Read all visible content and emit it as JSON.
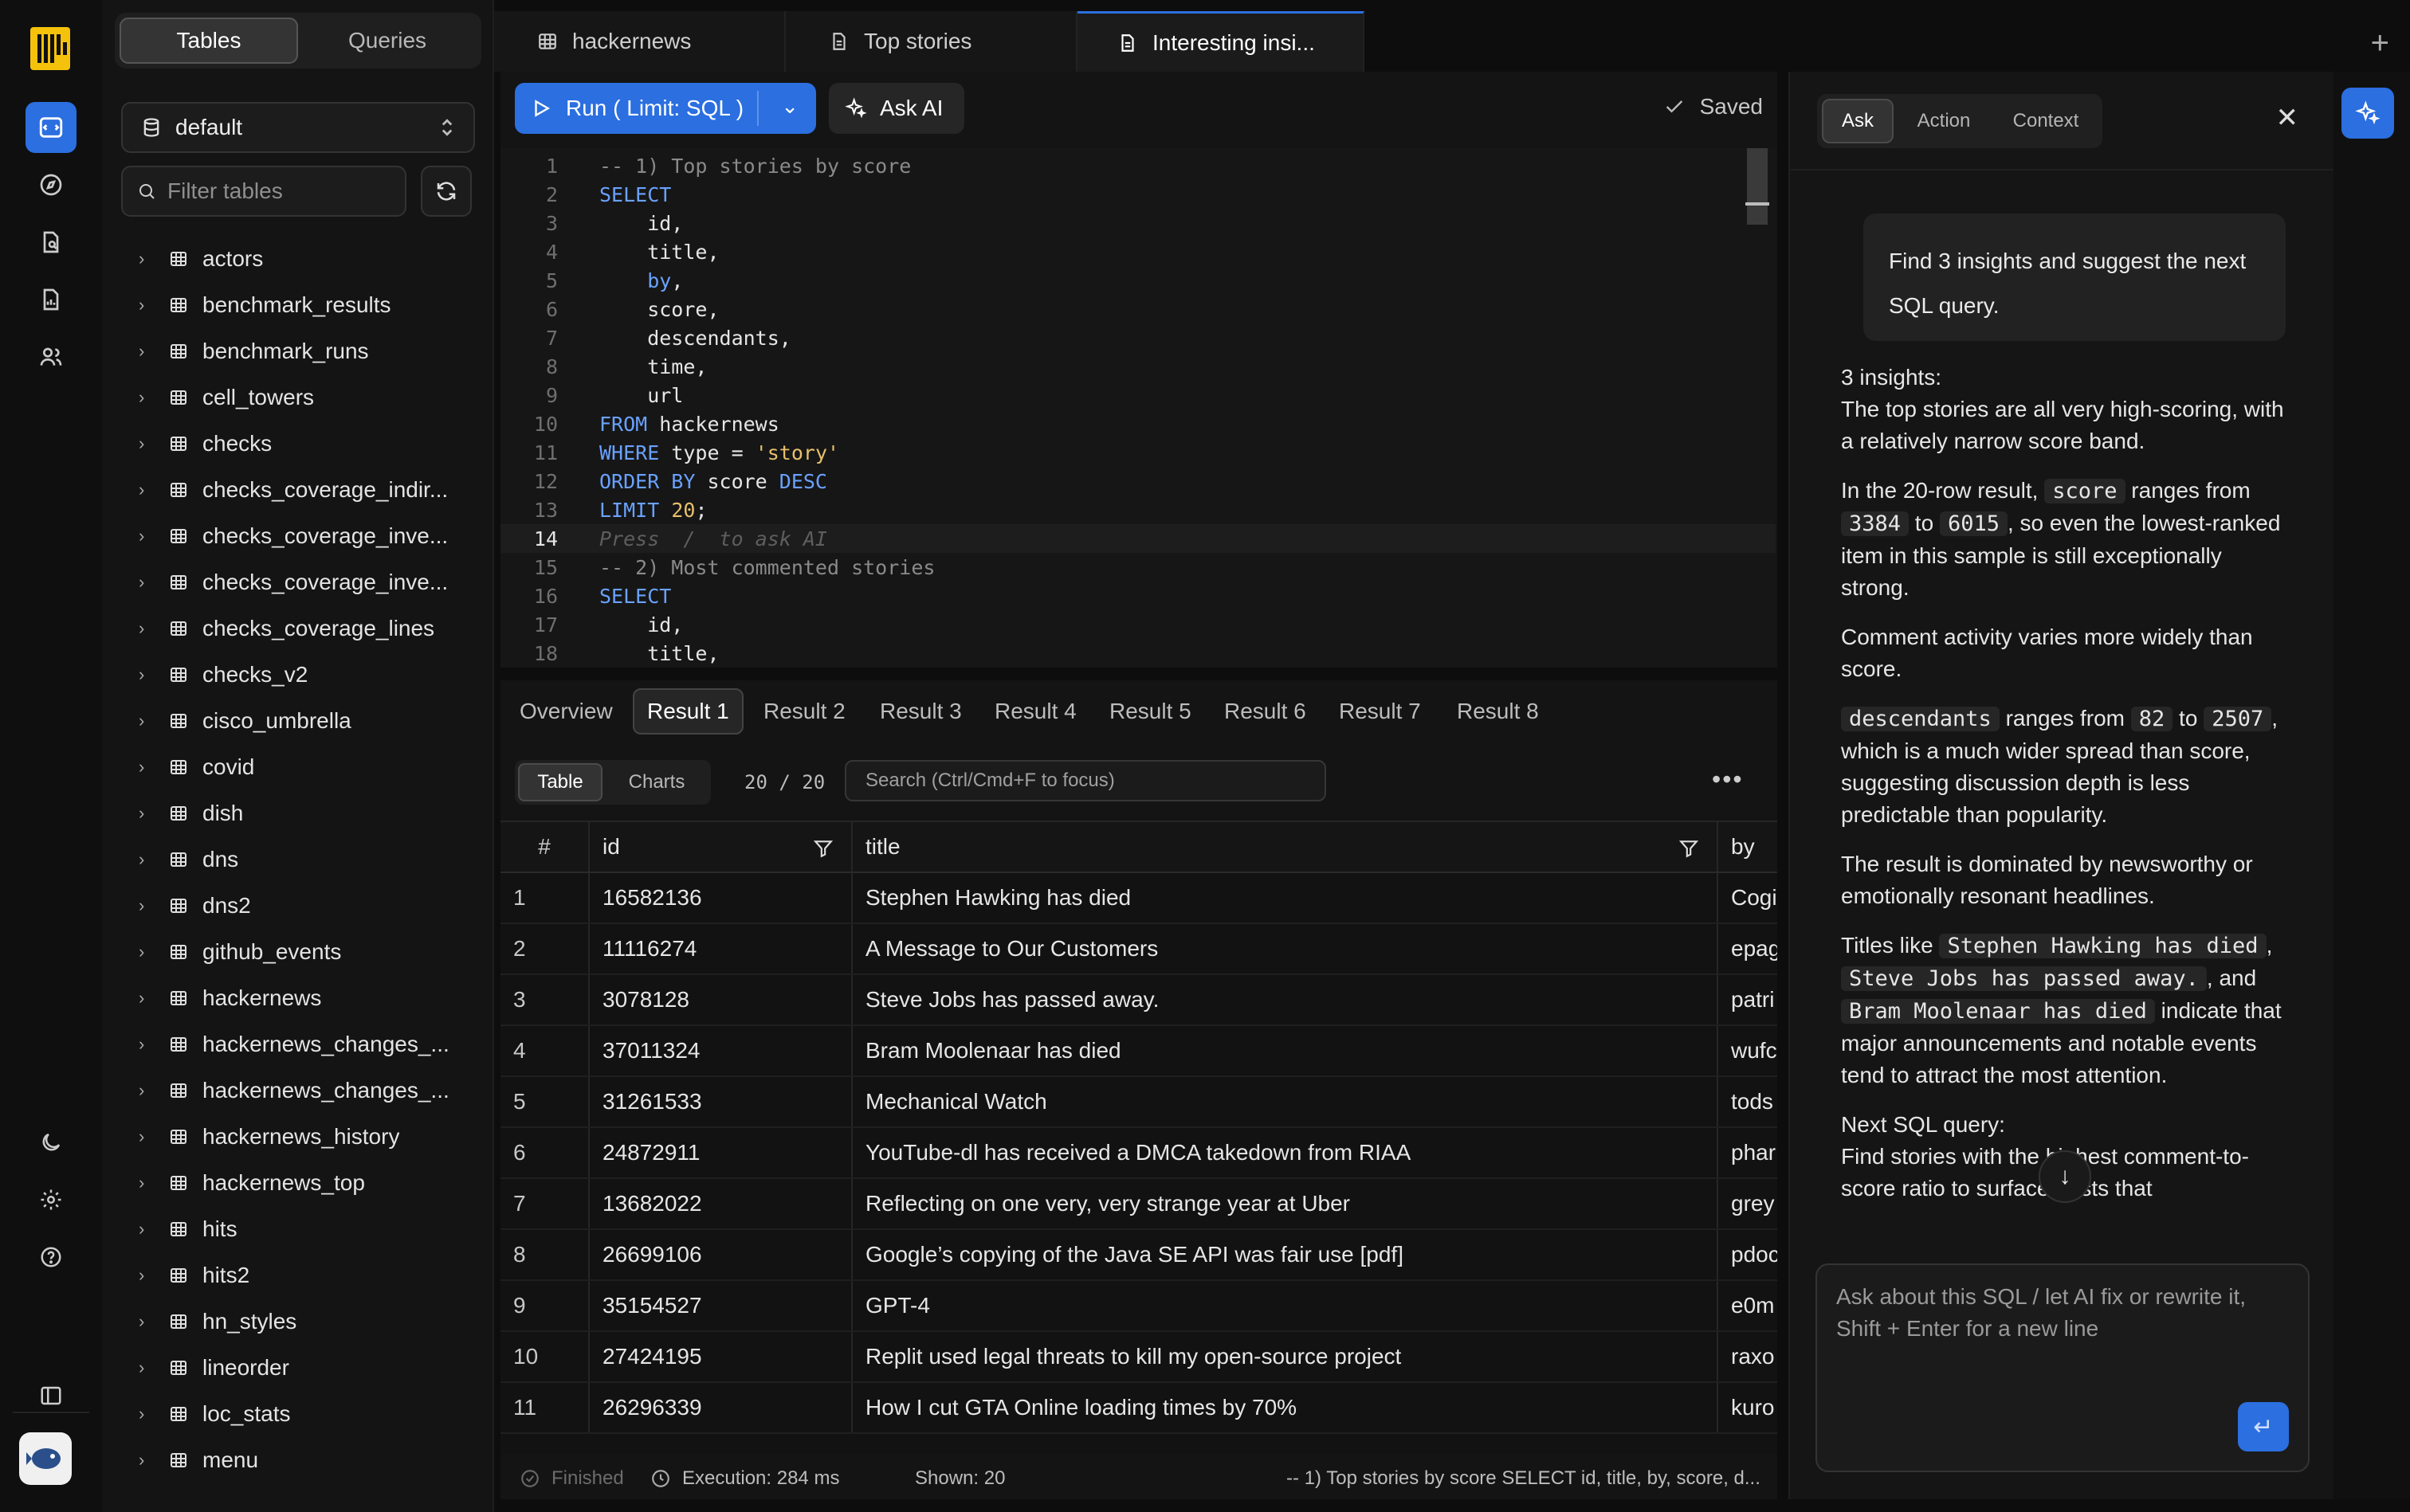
{
  "sidebar": {
    "mode_tabs": [
      "Tables",
      "Queries"
    ],
    "database": "default",
    "filter_placeholder": "Filter tables",
    "tables": [
      "actors",
      "benchmark_results",
      "benchmark_runs",
      "cell_towers",
      "checks",
      "checks_coverage_indir...",
      "checks_coverage_inve...",
      "checks_coverage_inve...",
      "checks_coverage_lines",
      "checks_v2",
      "cisco_umbrella",
      "covid",
      "dish",
      "dns",
      "dns2",
      "github_events",
      "hackernews",
      "hackernews_changes_...",
      "hackernews_changes_...",
      "hackernews_history",
      "hackernews_top",
      "hits",
      "hits2",
      "hn_styles",
      "lineorder",
      "loc_stats",
      "menu"
    ]
  },
  "tabs": [
    {
      "label": "hackernews",
      "icon": "table-icon"
    },
    {
      "label": "Top stories",
      "icon": "document-icon"
    },
    {
      "label": "Interesting insi...",
      "icon": "document-icon"
    }
  ],
  "toolbar": {
    "run_label": "Run ( Limit: SQL )",
    "ask_label": "Ask AI",
    "saved_label": "Saved"
  },
  "editor": {
    "lines": [
      {
        "n": "1",
        "html": "<span class=\"cm\">-- 1) Top stories by score</span>"
      },
      {
        "n": "2",
        "html": "<span class=\"kw\">SELECT</span>"
      },
      {
        "n": "3",
        "html": "    id,"
      },
      {
        "n": "4",
        "html": "    title,"
      },
      {
        "n": "5",
        "html": "    <span class=\"kw\">by</span>,"
      },
      {
        "n": "6",
        "html": "    score,"
      },
      {
        "n": "7",
        "html": "    descendants,"
      },
      {
        "n": "8",
        "html": "    time,"
      },
      {
        "n": "9",
        "html": "    url"
      },
      {
        "n": "10",
        "html": "<span class=\"kw\">FROM</span> hackernews"
      },
      {
        "n": "11",
        "html": "<span class=\"kw\">WHERE</span> type = <span class=\"str\">'story'</span>"
      },
      {
        "n": "12",
        "html": "<span class=\"kw\">ORDER BY</span> score <span class=\"kw\">DESC</span>"
      },
      {
        "n": "13",
        "html": "<span class=\"kw\">LIMIT</span> <span class=\"num\">20</span>;"
      },
      {
        "n": "14",
        "html": "<span class=\"hint\">Press  /  to ask AI</span>",
        "current": true
      },
      {
        "n": "15",
        "html": "<span class=\"cm\">-- 2) Most commented stories</span>"
      },
      {
        "n": "16",
        "html": "<span class=\"kw\">SELECT</span>"
      },
      {
        "n": "17",
        "html": "    id,"
      },
      {
        "n": "18",
        "html": "    title,"
      }
    ]
  },
  "results": {
    "tabs": [
      "Overview",
      "Result 1",
      "Result 2",
      "Result 3",
      "Result 4",
      "Result 5",
      "Result 6",
      "Result 7",
      "Result 8"
    ],
    "active_tab": "Result 1",
    "view_tabs": [
      "Table",
      "Charts"
    ],
    "count": "20 / 20",
    "search_placeholder": "Search (Ctrl/Cmd+F to focus)",
    "columns": [
      "#",
      "id",
      "title",
      "by"
    ],
    "rows": [
      [
        "1",
        "16582136",
        "Stephen Hawking has died",
        "Cogi"
      ],
      [
        "2",
        "11116274",
        "A Message to Our Customers",
        "epag"
      ],
      [
        "3",
        "3078128",
        "Steve Jobs has passed away.",
        "patri"
      ],
      [
        "4",
        "37011324",
        "Bram Moolenaar has died",
        "wufc"
      ],
      [
        "5",
        "31261533",
        "Mechanical Watch",
        "tods"
      ],
      [
        "6",
        "24872911",
        "YouTube-dl has received a DMCA takedown from RIAA",
        "phar"
      ],
      [
        "7",
        "13682022",
        "Reflecting on one very, very strange year at Uber",
        "grey"
      ],
      [
        "8",
        "26699106",
        "Google’s copying of the Java SE API was fair use [pdf]",
        "pdoc"
      ],
      [
        "9",
        "35154527",
        "GPT-4",
        "e0m"
      ],
      [
        "10",
        "27424195",
        "Replit used legal threats to kill my open-source project",
        "raxo"
      ],
      [
        "11",
        "26296339",
        "How I cut GTA Online loading times by 70%",
        "kuro"
      ]
    ]
  },
  "status": {
    "state": "Finished",
    "execution": "Execution: 284 ms",
    "shown": "Shown: 20",
    "query_preview": "-- 1) Top stories by score SELECT id, title, by, score, d..."
  },
  "ai": {
    "tabs": [
      "Ask",
      "Action",
      "Context"
    ],
    "user_message": "Find 3 insights and suggest the next SQL query.",
    "paragraphs": [
      {
        "html": "3 insights:<br>The top stories are all very high-scoring, with a relatively narrow score band."
      },
      {
        "html": "In the 20-row result, <span class=\"code\">score</span> ranges from <span class=\"code\">3384</span> to <span class=\"code\">6015</span>, so even the lowest-ranked item in this sample is still exceptionally strong."
      },
      {
        "html": "Comment activity varies more widely than score."
      },
      {
        "html": "<span class=\"code\">descendants</span> ranges from <span class=\"code\">82</span> to <span class=\"code\">2507</span>, which is a much wider spread than score, suggesting discussion depth is less predictable than popularity."
      },
      {
        "html": "The result is dominated by newsworthy or emotionally resonant headlines."
      },
      {
        "html": "Titles like <span class=\"code\">Stephen Hawking has died</span>, <span class=\"code\">Steve Jobs has passed away.</span>, and <span class=\"code\">Bram Moolenaar has died</span> indicate that major announcements and notable events tend to attract the most attention."
      },
      {
        "html": "Next SQL query:<br>Find stories with the highest comment-to-score ratio to surface posts that"
      }
    ],
    "input_placeholder": "Ask about this SQL / let AI fix or rewrite it, Shift + Enter for a new line"
  },
  "colors": {
    "accent": "#2b6fe0",
    "logo": "#f5c20b",
    "keyword": "#6aa2ff",
    "string": "#e8c06b"
  }
}
